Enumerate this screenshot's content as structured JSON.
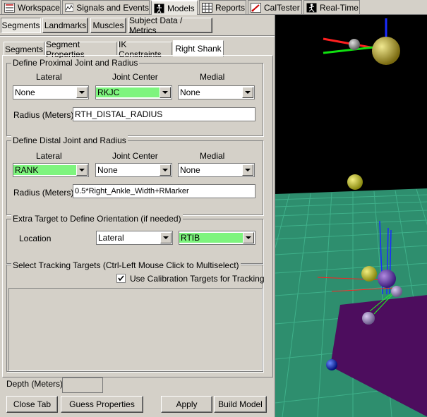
{
  "top_tabs": [
    {
      "label": "Workspace"
    },
    {
      "label": "Signals and Events"
    },
    {
      "label": "Models"
    },
    {
      "label": "Reports"
    },
    {
      "label": "CalTester"
    },
    {
      "label": "Real-Time"
    }
  ],
  "model_tabs": {
    "segments": "Segments",
    "landmarks": "Landmarks",
    "muscles": "Muscles",
    "subject_data": "Subject Data / Metrics"
  },
  "sub_tabs": {
    "segments": "Segments",
    "segment_properties": "Segment Properties",
    "ik_constraints": "IK Constraints",
    "right_shank": "Right Shank"
  },
  "proximal": {
    "title": "Define Proximal Joint and Radius",
    "lateral_header": "Lateral",
    "center_header": "Joint Center",
    "medial_header": "Medial",
    "lateral": "None",
    "center": "RKJC",
    "medial": "None",
    "radius_label": "Radius (Meters)",
    "radius_value": "RTH_DISTAL_RADIUS"
  },
  "distal": {
    "title": "Define Distal Joint and Radius",
    "lateral_header": "Lateral",
    "center_header": "Joint Center",
    "medial_header": "Medial",
    "lateral": "RANK",
    "center": "None",
    "medial": "None",
    "radius_label": "Radius (Meters)",
    "radius_value": "0.5*Right_Ankle_Width+RMarker"
  },
  "extra": {
    "title": "Extra Target to Define Orientation (if needed)",
    "location_label": "Location",
    "location_value": "Lateral",
    "target_value": "RTIB"
  },
  "tracking": {
    "title": "Select Tracking Targets (Ctrl-Left Mouse Click to Multiselect)",
    "checkbox_label": "Use Calibration Targets for Tracking",
    "checked": true
  },
  "depth": {
    "label": "Depth (Meters):",
    "value": ""
  },
  "buttons": {
    "close_tab": "Close Tab",
    "guess_properties": "Guess Properties",
    "apply": "Apply",
    "build_model": "Build Model"
  },
  "colors": {
    "highlight_green": "#7ef47e",
    "viewport_bg": "#000000",
    "floor": "#2e8e6e",
    "plate": "#4d0d5e"
  }
}
